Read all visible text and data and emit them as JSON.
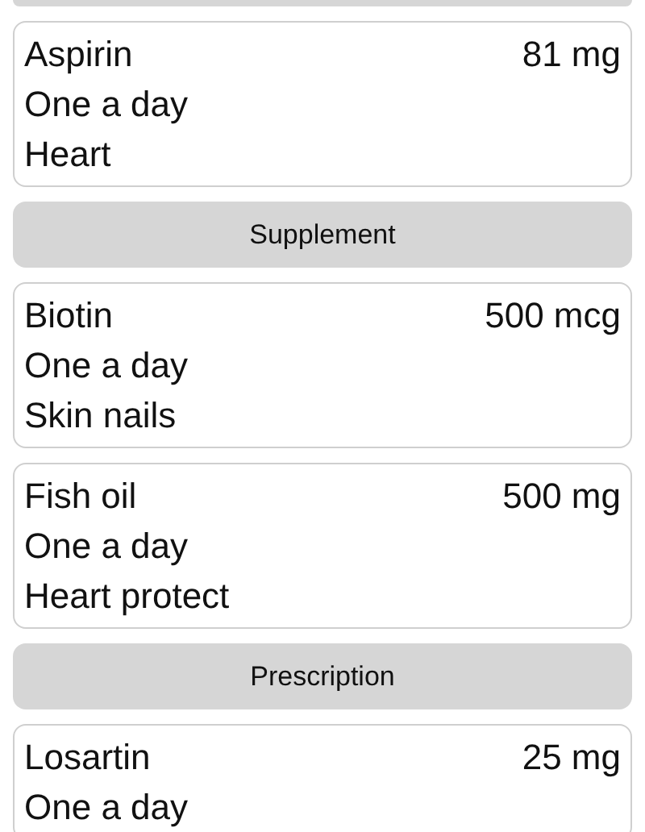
{
  "items": [
    {
      "kind": "card",
      "name": "Aspirin",
      "dose": "81 mg",
      "frequency": "One a day",
      "note": "Heart"
    },
    {
      "kind": "header",
      "label": "Supplement"
    },
    {
      "kind": "card",
      "name": "Biotin",
      "dose": "500 mcg",
      "frequency": "One a day",
      "note": "Skin nails"
    },
    {
      "kind": "card",
      "name": "Fish oil",
      "dose": "500 mg",
      "frequency": "One a day",
      "note": "Heart protect"
    },
    {
      "kind": "header",
      "label": "Prescription"
    },
    {
      "kind": "card",
      "name": "Losartin",
      "dose": "25 mg",
      "frequency": "One a day"
    }
  ]
}
